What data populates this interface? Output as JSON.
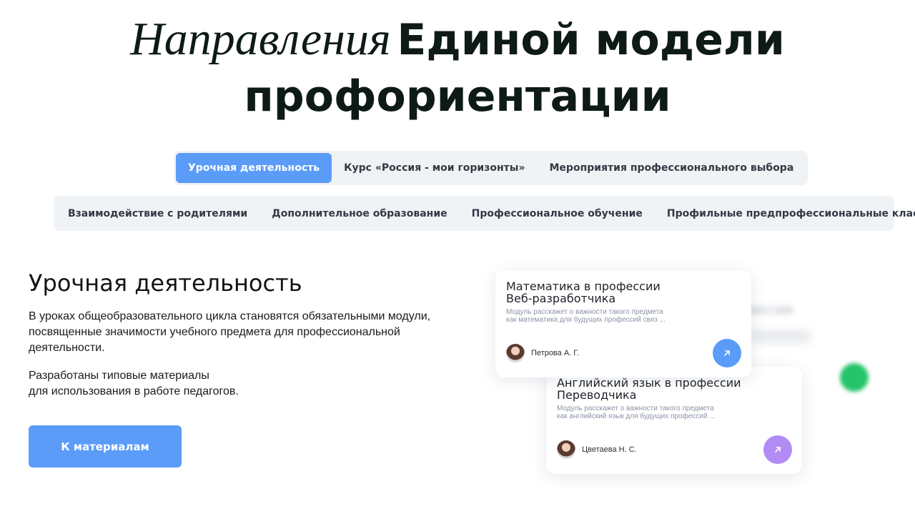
{
  "heading": {
    "italic": "Направления",
    "bold_line1": "Единой модели",
    "bold_line2": "профориентации"
  },
  "tabs_row1": [
    {
      "label": "Урочная деятельность",
      "active": true
    },
    {
      "label": "Курс «Россия - мои горизонты»",
      "active": false
    },
    {
      "label": "Мероприятия профессионального выбора",
      "active": false
    }
  ],
  "tabs_row2": [
    {
      "label": "Взаимодействие с родителями",
      "active": false
    },
    {
      "label": "Дополнительное образование",
      "active": false
    },
    {
      "label": "Профессиональное обучение",
      "active": false
    },
    {
      "label": "Профильные предпрофессиональные классы",
      "active": false
    }
  ],
  "section": {
    "title": "Урочная деятельность",
    "paragraph1": "В уроках общеобразовательного цикла становятся обязательными модули, посвященные значимости учебного предмета для профессиональной деятельности.",
    "paragraph2_line1": "Разработаны типовые материалы",
    "paragraph2_line2": "для использования в работе педагогов.",
    "button": "К материалам"
  },
  "cards": [
    {
      "title_line1": "Математика в профессии",
      "title_line2": "Веб-разработчика",
      "desc_line1": "Модуль расскажет о важности такого предмета",
      "desc_line2": "как математика для будущих профессий связ ...",
      "author": "Петрова А. Г.",
      "button_icon": "arrow-up-right-icon",
      "button_color": "#5a9cf8"
    },
    {
      "title_line1": "Английский язык в профессии",
      "title_line2": "Переводчика",
      "desc_line1": "Модуль расскажет о важности такого предмета",
      "desc_line2": "как английский язык для будущих профессий ...",
      "author": "Цветаева Н. С.",
      "button_icon": "arrow-up-right-icon",
      "button_color": "#b28bf5"
    }
  ],
  "ghost_card": {
    "title": "фессии"
  },
  "colors": {
    "accent": "#5a9cf8",
    "tab_bg": "#f0f3f6",
    "purple": "#b28bf5",
    "green": "#26c46a",
    "heading": "#0d1b14"
  }
}
